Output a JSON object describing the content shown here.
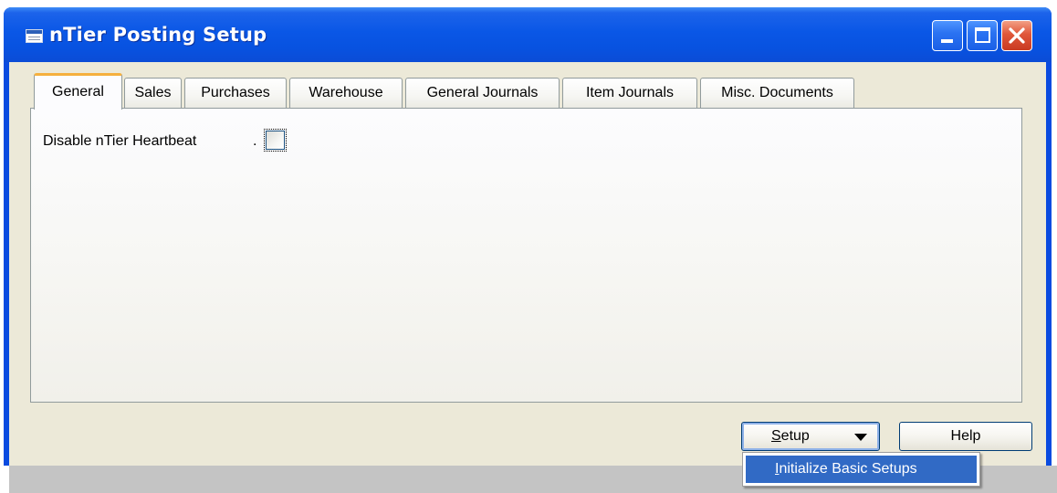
{
  "window": {
    "title": "nTier Posting Setup"
  },
  "tabs": [
    {
      "label": "General",
      "active": true
    },
    {
      "label": "Sales"
    },
    {
      "label": "Purchases"
    },
    {
      "label": "Warehouse"
    },
    {
      "label": "General Journals"
    },
    {
      "label": "Item Journals"
    },
    {
      "label": "Misc. Documents"
    }
  ],
  "general": {
    "field_label": "Disable nTier Heartbeat",
    "field_dots": ".",
    "checkbox_checked": false
  },
  "buttons": {
    "setup_mnemonic": "S",
    "setup_rest": "etup",
    "help_label": "Help"
  },
  "menu": {
    "item_mnemonic": "I",
    "item_rest": "nitialize Basic Setups"
  },
  "colors": {
    "titlebar": "#0a57e6",
    "active_tab_accent": "#f5b03e",
    "menu_highlight": "#316ac5",
    "client_background": "#ece9d8"
  },
  "icons": {
    "title_icon": "table-icon",
    "minimize": "minimize-icon",
    "maximize": "maximize-icon",
    "close": "close-icon",
    "setup_arrow": "dropdown-arrow-icon"
  }
}
